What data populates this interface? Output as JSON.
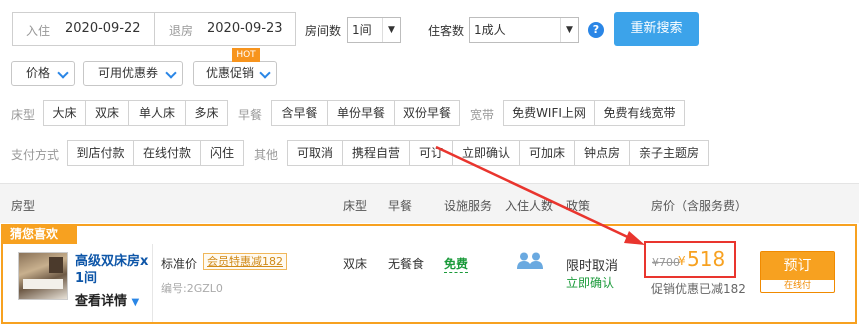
{
  "search": {
    "checkin_label": "入住",
    "checkin_value": "2020-09-22",
    "checkout_label": "退房",
    "checkout_value": "2020-09-23",
    "rooms_label": "房间数",
    "rooms_value": "1间",
    "guests_label": "住客数",
    "guests_value": "1成人",
    "help_icon": "?",
    "search_button": "重新搜索"
  },
  "filters": {
    "price": "价格",
    "coupon": "可用优惠券",
    "promo": "优惠促销",
    "hot_badge": "HOT"
  },
  "bed": {
    "label": "床型",
    "options": [
      "大床",
      "双床",
      "单人床",
      "多床"
    ]
  },
  "breakfast": {
    "label": "早餐",
    "options": [
      "含早餐",
      "单份早餐",
      "双份早餐"
    ]
  },
  "broadband": {
    "label": "宽带",
    "options": [
      "免费WIFI上网",
      "免费有线宽带"
    ]
  },
  "payment": {
    "label": "支付方式",
    "options": [
      "到店付款",
      "在线付款",
      "闪住"
    ]
  },
  "other": {
    "label": "其他",
    "options": [
      "可取消",
      "携程自营",
      "可订",
      "立即确认",
      "可加床",
      "钟点房",
      "亲子主题房"
    ]
  },
  "table": {
    "headers": [
      "房型",
      "床型",
      "早餐",
      "设施服务",
      "入住人数",
      "政策",
      "房价（含服务费）"
    ]
  },
  "room": {
    "badge": "猜您喜欢",
    "name_line1": "高级双床房x",
    "name_line2": "1间",
    "details": "查看详情",
    "rate_name": "标准价",
    "member_tag": "会员特惠减182",
    "code": "编号:2GZL0",
    "bed": "双床",
    "breakfast": "无餐食",
    "facility": "免费",
    "policy": "限时取消",
    "confirm": "立即确认",
    "old_price": "¥700",
    "currency": "¥",
    "price": "518",
    "discount": "促销优惠已减182",
    "book_button": "预订",
    "pay_tag": "在线付"
  },
  "colors": {
    "accent": "#2a86e6",
    "orange": "#f7a120",
    "red": "#e9352e",
    "green": "#1a9a3a"
  }
}
